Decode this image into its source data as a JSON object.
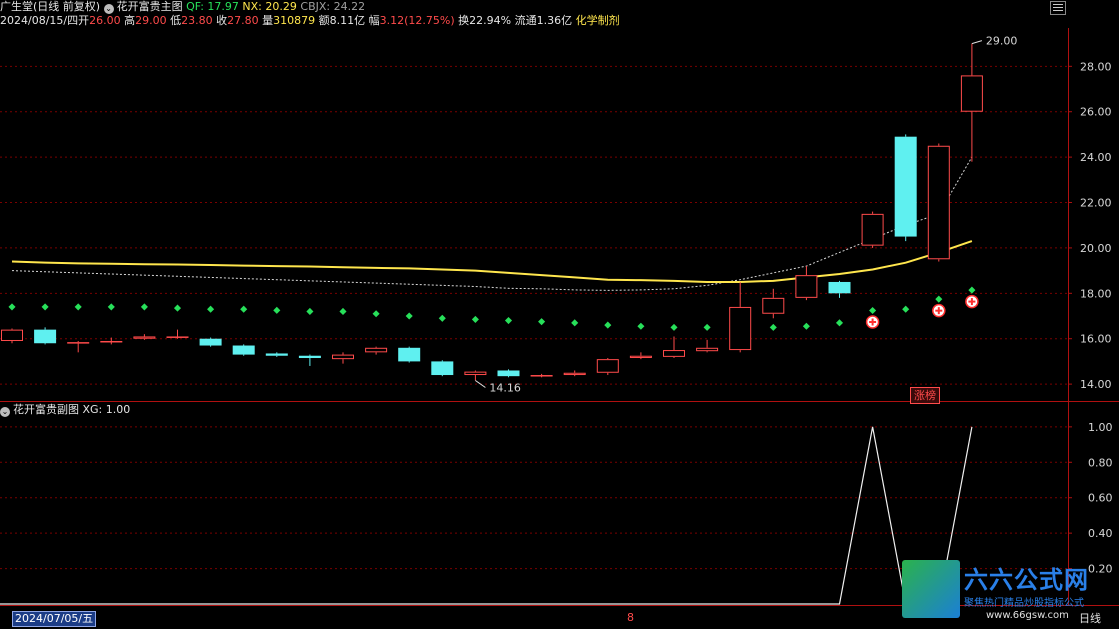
{
  "header": {
    "stock_name": "广生堂(日线 前复权)",
    "indicator_name": "花开富贵主图",
    "qf_label": "QF: 17.97",
    "nx_label": "NX: 20.29",
    "cbjx_label": "CBJX: 24.22",
    "date": "2024/08/15/四",
    "open_label": "开",
    "open": "26.00",
    "high_label": "高",
    "high": "29.00",
    "low_label": "低",
    "low": "23.80",
    "close_label": "收",
    "close": "27.80",
    "volume_label": "量",
    "volume": "310879",
    "amount_label": "额",
    "amount": "8.11亿",
    "range_label": "幅",
    "range": "3.12(12.75%)",
    "turnover": "换22.94%",
    "float_cap": "流通1.36亿",
    "industry": "化学制剂"
  },
  "sub_header": {
    "indicator_name": "花开富贵副图",
    "xg_label": "XG: 1.00"
  },
  "footer": {
    "date_box": "2024/07/05/五",
    "eight": "8",
    "day_label": "日线"
  },
  "badge": {
    "zhangbang": "涨榜"
  },
  "logo": {
    "title": "六六公式网",
    "subtitle": "聚焦热门精品炒股指标公式",
    "url": "www.66gsw.com"
  },
  "colors": {
    "up": "#ff4b4b",
    "down": "#5ff0f0",
    "ma_yellow": "#ffe64d",
    "dot_green": "#27e05a",
    "grid": "#7a0000"
  },
  "chart_data": [
    {
      "type": "candlestick",
      "title": "花开富贵主图",
      "ylim": [
        13.3,
        29.6
      ],
      "y_ticks": [
        14.0,
        16.0,
        18.0,
        20.0,
        22.0,
        24.0,
        26.0,
        28.0
      ],
      "y_tick_labels": [
        "14.00",
        "16.00",
        "18.00",
        "20.00",
        "22.00",
        "24.00",
        "26.00",
        "28.00"
      ],
      "candles": [
        {
          "o": 15.9,
          "c": 16.4,
          "h": 16.45,
          "l": 15.8
        },
        {
          "o": 16.4,
          "c": 15.8,
          "h": 16.5,
          "l": 15.75
        },
        {
          "o": 15.8,
          "c": 15.85,
          "h": 15.9,
          "l": 15.4
        },
        {
          "o": 15.9,
          "c": 15.9,
          "h": 16.05,
          "l": 15.75
        },
        {
          "o": 16.0,
          "c": 16.1,
          "h": 16.2,
          "l": 15.95
        },
        {
          "o": 16.1,
          "c": 16.1,
          "h": 16.4,
          "l": 16.0
        },
        {
          "o": 16.0,
          "c": 15.7,
          "h": 16.05,
          "l": 15.65
        },
        {
          "o": 15.7,
          "c": 15.3,
          "h": 15.75,
          "l": 15.25
        },
        {
          "o": 15.35,
          "c": 15.25,
          "h": 15.4,
          "l": 15.2
        },
        {
          "o": 15.25,
          "c": 15.15,
          "h": 15.3,
          "l": 14.8
        },
        {
          "o": 15.1,
          "c": 15.3,
          "h": 15.4,
          "l": 14.9
        },
        {
          "o": 15.4,
          "c": 15.6,
          "h": 15.65,
          "l": 15.3
        },
        {
          "o": 15.6,
          "c": 15.0,
          "h": 15.65,
          "l": 14.95
        },
        {
          "o": 15.0,
          "c": 14.4,
          "h": 15.05,
          "l": 14.35
        },
        {
          "o": 14.4,
          "c": 14.55,
          "h": 14.6,
          "l": 14.16
        },
        {
          "o": 14.6,
          "c": 14.35,
          "h": 14.65,
          "l": 14.3
        },
        {
          "o": 14.4,
          "c": 14.4,
          "h": 14.45,
          "l": 14.3
        },
        {
          "o": 14.4,
          "c": 14.5,
          "h": 14.6,
          "l": 14.35
        },
        {
          "o": 14.5,
          "c": 15.1,
          "h": 15.15,
          "l": 14.4
        },
        {
          "o": 15.15,
          "c": 15.25,
          "h": 15.4,
          "l": 15.1
        },
        {
          "o": 15.2,
          "c": 15.5,
          "h": 16.1,
          "l": 15.15
        },
        {
          "o": 15.45,
          "c": 15.6,
          "h": 15.95,
          "l": 15.4
        },
        {
          "o": 15.5,
          "c": 17.4,
          "h": 18.5,
          "l": 15.4
        },
        {
          "o": 17.1,
          "c": 17.8,
          "h": 18.2,
          "l": 16.9
        },
        {
          "o": 17.8,
          "c": 18.8,
          "h": 19.2,
          "l": 17.7
        },
        {
          "o": 18.5,
          "c": 18.0,
          "h": 18.55,
          "l": 17.8
        },
        {
          "o": 20.1,
          "c": 21.5,
          "h": 21.6,
          "l": 20.0
        },
        {
          "o": 24.9,
          "c": 20.5,
          "h": 25.0,
          "l": 20.3
        },
        {
          "o": 19.5,
          "c": 24.5,
          "h": 24.6,
          "l": 19.4
        },
        {
          "o": 26.0,
          "c": 27.6,
          "h": 29.0,
          "l": 23.8
        }
      ],
      "ma_yellow": [
        19.4,
        19.35,
        19.32,
        19.3,
        19.28,
        19.27,
        19.25,
        19.22,
        19.2,
        19.18,
        19.15,
        19.12,
        19.1,
        19.05,
        19.0,
        18.9,
        18.8,
        18.7,
        18.6,
        18.58,
        18.55,
        18.5,
        18.5,
        18.55,
        18.7,
        18.85,
        19.05,
        19.35,
        19.8,
        20.3
      ],
      "ma_dashed": [
        19.0,
        18.95,
        18.9,
        18.85,
        18.8,
        18.75,
        18.7,
        18.65,
        18.6,
        18.55,
        18.5,
        18.45,
        18.4,
        18.35,
        18.3,
        18.22,
        18.2,
        18.15,
        18.13,
        18.15,
        18.2,
        18.35,
        18.6,
        18.9,
        19.2,
        19.8,
        20.4,
        21.0,
        21.5,
        24.0
      ],
      "green_dots": [
        17.4,
        17.4,
        17.4,
        17.4,
        17.4,
        17.35,
        17.3,
        17.3,
        17.25,
        17.2,
        17.2,
        17.1,
        17.0,
        16.9,
        16.85,
        16.8,
        16.75,
        16.7,
        16.6,
        16.55,
        16.5,
        16.5,
        16.5,
        16.5,
        16.55,
        16.7,
        17.0,
        17.3,
        17.5,
        17.9
      ],
      "markers": [
        26,
        28,
        29
      ],
      "annotations": [
        {
          "index": 14,
          "value": 14.16,
          "text": "14.16"
        },
        {
          "index": 29,
          "value": 29.0,
          "text": "29.00"
        }
      ]
    },
    {
      "type": "line",
      "title": "花开富贵副图",
      "ylim": [
        0,
        1.05
      ],
      "y_ticks": [
        0.2,
        0.4,
        0.6,
        0.8,
        1.0
      ],
      "y_tick_labels": [
        "0.20",
        "0.40",
        "0.60",
        "0.80",
        "1.00"
      ],
      "series": [
        {
          "name": "XG",
          "values": [
            0,
            0,
            0,
            0,
            0,
            0,
            0,
            0,
            0,
            0,
            0,
            0,
            0,
            0,
            0,
            0,
            0,
            0,
            0,
            0,
            0,
            0,
            0,
            0,
            0,
            0,
            1,
            0,
            0,
            1
          ]
        }
      ]
    }
  ]
}
